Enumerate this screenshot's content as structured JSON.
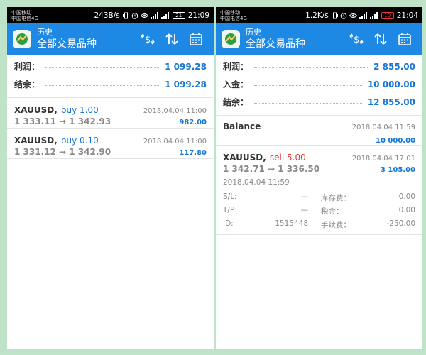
{
  "screens": [
    {
      "status": {
        "carrier_line1": "中国移动",
        "carrier_line2": "中国电信4G",
        "speed": "243B/s",
        "battery": "21",
        "time": "21:09"
      },
      "header": {
        "title": "历史",
        "subtitle": "全部交易品种",
        "icons": [
          "dollar-swap-icon",
          "sort-icon",
          "calendar-icon"
        ]
      },
      "summary": [
        {
          "label": "利润：",
          "value": "1 099.28"
        },
        {
          "label": "结余：",
          "value": "1 099.28"
        }
      ],
      "trades": [
        {
          "symbol": "XAUUSD,",
          "side": "buy 1.00",
          "time": "2018.04.04 11:00",
          "prices": "1 333.11 → 1 342.93",
          "profit": "982.00"
        },
        {
          "symbol": "XAUUSD,",
          "side": "buy 0.10",
          "time": "2018.04.04 11:00",
          "prices": "1 331.12 → 1 342.90",
          "profit": "117.80"
        }
      ]
    },
    {
      "status": {
        "carrier_line1": "中国移动",
        "carrier_line2": "中国电信4G",
        "speed": "1.2K/s",
        "battery": "10",
        "time": "21:04"
      },
      "header": {
        "title": "历史",
        "subtitle": "全部交易品种",
        "icons": [
          "dollar-swap-icon",
          "sort-icon",
          "calendar-icon"
        ]
      },
      "summary": [
        {
          "label": "利润：",
          "value": "2 855.00"
        },
        {
          "label": "入金：",
          "value": "10 000.00"
        },
        {
          "label": "结余：",
          "value": "12 855.00"
        }
      ],
      "balance": {
        "label": "Balance",
        "time": "2018.04.04 11:59",
        "amount": "10 000.00"
      },
      "trade": {
        "symbol": "XAUUSD,",
        "side": "sell 5.00",
        "time": "2018.04.04 17:01",
        "prices": "1 342.71 → 1 336.50",
        "profit": "3 105.00",
        "open_time": "2018.04.04 11:59",
        "details": {
          "sl_label": "S/L:",
          "sl_value": "—",
          "swap_label": "库存费：",
          "swap_value": "0.00",
          "tp_label": "T/P:",
          "tp_value": "—",
          "tax_label": "税金：",
          "tax_value": "0.00",
          "id_label": "ID:",
          "id_value": "1515448",
          "fee_label": "手续费：",
          "fee_value": "-250.00"
        }
      }
    }
  ],
  "colors": {
    "app_bar": "#1e88e5",
    "value_blue": "#1976d2",
    "sell_red": "#e53935",
    "background_green": "#bfe3c9"
  }
}
